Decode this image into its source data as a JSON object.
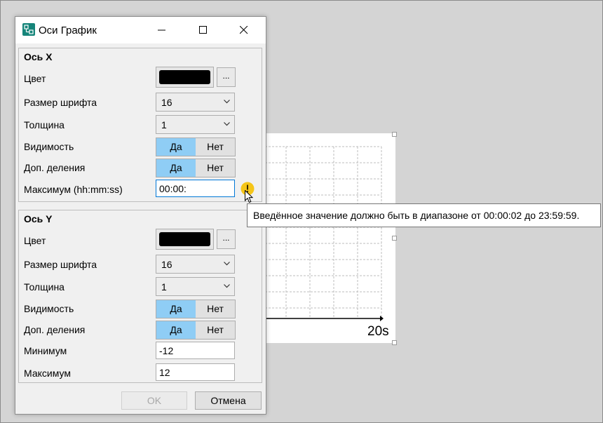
{
  "dialog": {
    "title": "Оси График",
    "controls": {
      "minimize": "minimize-icon",
      "maximize": "maximize-icon",
      "close": "close-icon"
    },
    "x_axis": {
      "title": "Ось X",
      "color_label": "Цвет",
      "color_value": "#000000",
      "color_more_label": "...",
      "font_size_label": "Размер шрифта",
      "font_size_value": "16",
      "thickness_label": "Толщина",
      "thickness_value": "1",
      "visibility_label": "Видимость",
      "subdivisions_label": "Доп. деления",
      "yes_label": "Да",
      "no_label": "Нет",
      "max_label": "Максимум (hh:mm:ss)",
      "max_value": "00:00:"
    },
    "y_axis": {
      "title": "Ось Y",
      "color_label": "Цвет",
      "color_value": "#000000",
      "color_more_label": "...",
      "font_size_label": "Размер шрифта",
      "font_size_value": "16",
      "thickness_label": "Толщина",
      "thickness_value": "1",
      "visibility_label": "Видимость",
      "subdivisions_label": "Доп. деления",
      "yes_label": "Да",
      "no_label": "Нет",
      "min_label": "Минимум",
      "min_value": "-12",
      "max_label": "Максимум",
      "max_value": "12"
    },
    "ok_label": "OK",
    "cancel_label": "Отмена"
  },
  "tooltip": {
    "text": "Введённое значение должно быть в диапазоне от 00:00:02 до 23:59:59.",
    "icon": "warning-icon"
  },
  "chart": {
    "x_max_label": "20s"
  },
  "colors": {
    "accent_selected": "#8fcdf5",
    "app_icon": "#16857a",
    "warning": "#f5c518",
    "focus_border": "#0078d7"
  }
}
